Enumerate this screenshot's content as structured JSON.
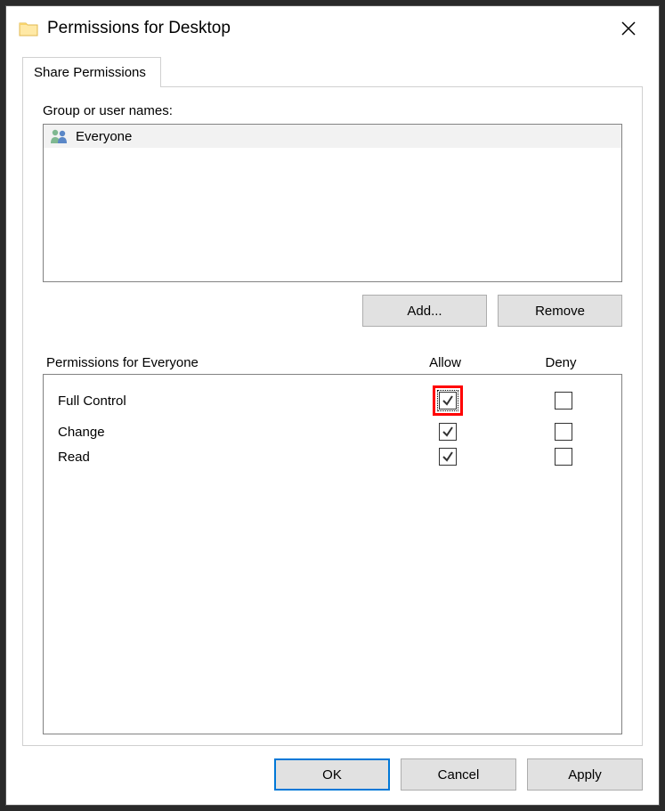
{
  "window": {
    "title": "Permissions for Desktop"
  },
  "tab": {
    "label": "Share Permissions"
  },
  "groups": {
    "label": "Group or user names:",
    "items": [
      {
        "name": "Everyone"
      }
    ],
    "add_label": "Add...",
    "remove_label": "Remove"
  },
  "perms": {
    "header_label": "Permissions for Everyone",
    "allow_label": "Allow",
    "deny_label": "Deny",
    "rows": [
      {
        "name": "Full Control",
        "allow": true,
        "deny": false,
        "highlight_allow": true,
        "focused": true
      },
      {
        "name": "Change",
        "allow": true,
        "deny": false,
        "highlight_allow": false,
        "focused": false
      },
      {
        "name": "Read",
        "allow": true,
        "deny": false,
        "highlight_allow": false,
        "focused": false
      }
    ]
  },
  "buttons": {
    "ok": "OK",
    "cancel": "Cancel",
    "apply": "Apply"
  }
}
